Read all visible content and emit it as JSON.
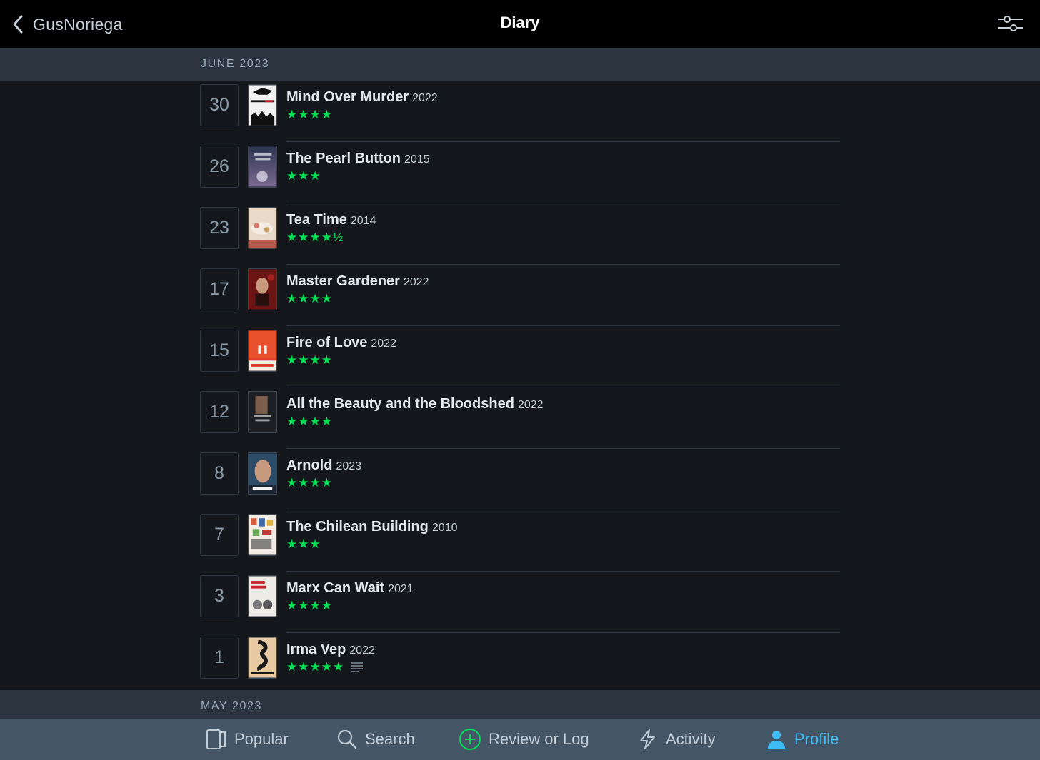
{
  "header": {
    "back_label": "GusNoriega",
    "title": "Diary"
  },
  "sections": {
    "june": "JUNE 2023",
    "may": "MAY 2023"
  },
  "entries": [
    {
      "day": "30",
      "title": "Mind Over Murder",
      "year": "2022",
      "rating": "★★★★",
      "has_review": false
    },
    {
      "day": "26",
      "title": "The Pearl Button",
      "year": "2015",
      "rating": "★★★",
      "has_review": false
    },
    {
      "day": "23",
      "title": "Tea Time",
      "year": "2014",
      "rating": "★★★★½",
      "has_review": false
    },
    {
      "day": "17",
      "title": "Master Gardener",
      "year": "2022",
      "rating": "★★★★",
      "has_review": false
    },
    {
      "day": "15",
      "title": "Fire of Love",
      "year": "2022",
      "rating": "★★★★",
      "has_review": false
    },
    {
      "day": "12",
      "title": "All the Beauty and the Bloodshed",
      "year": "2022",
      "rating": "★★★★",
      "has_review": false
    },
    {
      "day": "8",
      "title": "Arnold",
      "year": "2023",
      "rating": "★★★★",
      "has_review": false
    },
    {
      "day": "7",
      "title": "The Chilean Building",
      "year": "2010",
      "rating": "★★★",
      "has_review": false
    },
    {
      "day": "3",
      "title": "Marx Can Wait",
      "year": "2021",
      "rating": "★★★★",
      "has_review": false
    },
    {
      "day": "1",
      "title": "Irma Vep",
      "year": "2022",
      "rating": "★★★★★",
      "has_review": true
    }
  ],
  "tabs": {
    "popular": "Popular",
    "search": "Search",
    "log": "Review or Log",
    "activity": "Activity",
    "profile": "Profile"
  },
  "colors": {
    "star": "#00e054",
    "active_tab": "#40bcf4",
    "tab_bar": "#445566",
    "section_header": "#2c3440"
  }
}
